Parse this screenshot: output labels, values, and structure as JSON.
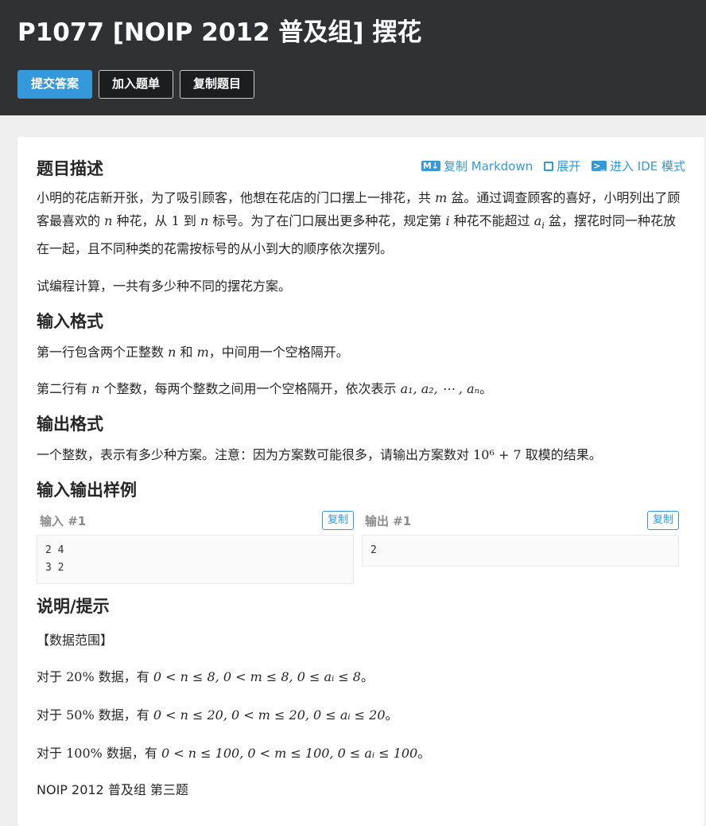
{
  "header": {
    "title": "P1077 [NOIP 2012 普及组] 摆花",
    "buttons": [
      "提交答案",
      "加入题单",
      "复制题目"
    ]
  },
  "toolbar": {
    "copy_markdown": "复制 Markdown",
    "expand": "展开",
    "ide_mode": "进入 IDE 模式"
  },
  "sections": {
    "desc_title": "题目描述",
    "input_title": "输入格式",
    "output_title": "输出格式",
    "samples_title": "输入输出样例",
    "hint_title": "说明/提示"
  },
  "description": {
    "p1_a": "小明的花店新开张，为了吸引顾客，他想在花店的门口摆上一排花，共 ",
    "p1_m": "m",
    "p1_b": " 盆。通过调查顾客的喜好，小明列出了顾客最喜欢的 ",
    "p1_n": "n",
    "p1_c": " 种花，从 ",
    "p1_1": "1",
    "p1_d": " 到 ",
    "p1_n2": "n",
    "p1_e": " 标号。为了在门口展出更多种花，规定第 ",
    "p1_i": "i",
    "p1_f": " 种花不能超过 ",
    "p1_ai": "a",
    "p1_ai_sub": "i",
    "p1_g": " 盆，摆花时同一种花放在一起，且不同种类的花需按标号的从小到大的顺序依次摆列。",
    "p2": "试编程计算，一共有多少种不同的摆花方案。"
  },
  "input_format": {
    "l1_a": "第一行包含两个正整数 ",
    "l1_n": "n",
    "l1_b": " 和 ",
    "l1_m": "m",
    "l1_c": "，中间用一个空格隔开。",
    "l2_a": "第二行有 ",
    "l2_n": "n",
    "l2_b": " 个整数，每两个整数之间用一个空格隔开，依次表示 ",
    "l2_seq": "a₁, a₂, ⋯ , aₙ",
    "l2_c": "。"
  },
  "output_format": {
    "a": "一个整数，表示有多少种方案。注意：因为方案数可能很多，请输出方案数对 ",
    "expr": "10⁶ + 7",
    "b": " 取模的结果。"
  },
  "samples": {
    "input_label": "输入 #1",
    "output_label": "输出 #1",
    "copy": "复制",
    "input_content": "2 4\n3 2",
    "output_content": "2"
  },
  "hint": {
    "range_label": "【数据范围】",
    "r1_a": "对于 ",
    "r1_pct": "20%",
    "r1_b": " 数据，有 ",
    "r1_expr": "0 < n ≤ 8, 0 < m ≤ 8, 0 ≤ aᵢ ≤ 8",
    "r1_c": "。",
    "r2_a": "对于 ",
    "r2_pct": "50%",
    "r2_b": " 数据，有 ",
    "r2_expr": "0 < n ≤ 20, 0 < m ≤ 20, 0 ≤ aᵢ ≤ 20",
    "r2_c": "。",
    "r3_a": "对于 ",
    "r3_pct": "100%",
    "r3_b": " 数据，有 ",
    "r3_expr": "0 < n ≤ 100, 0 < m ≤ 100, 0 ≤ aᵢ ≤ 100",
    "r3_c": "。",
    "source": "NOIP 2012 普及组 第三题"
  }
}
